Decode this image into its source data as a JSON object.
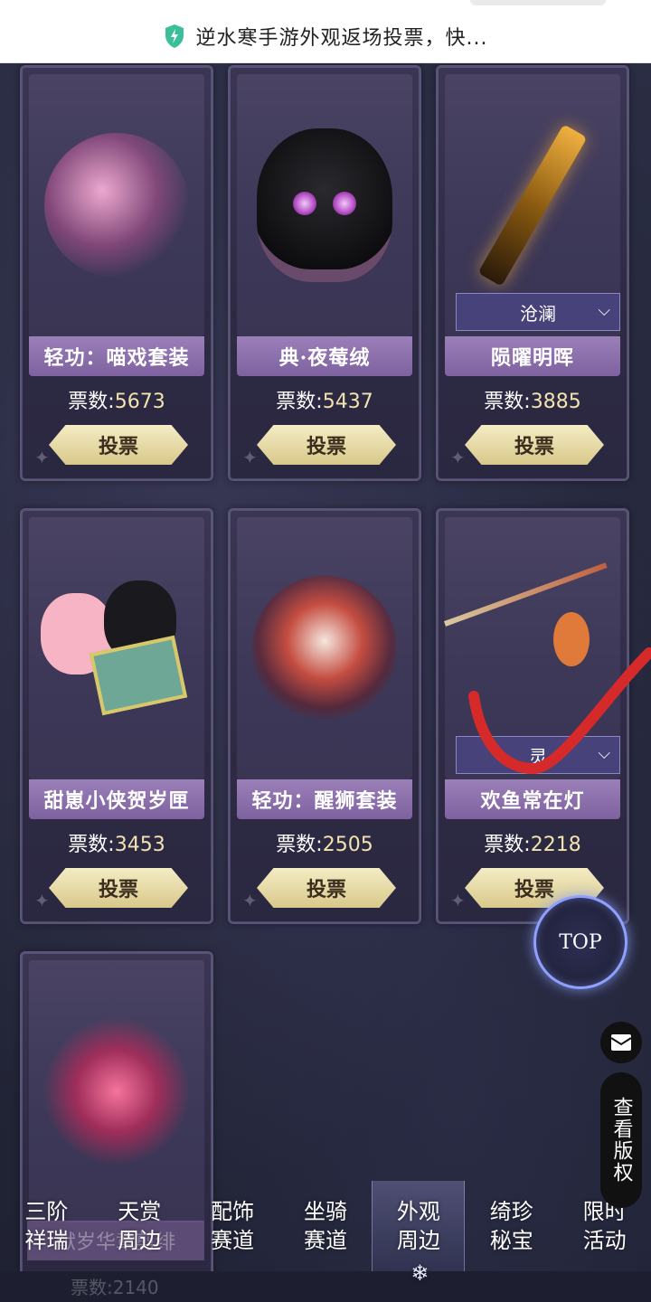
{
  "topbar": {
    "title": "逆水寒手游外观返场投票，快..."
  },
  "cards": [
    {
      "name": "轻功：喵戏套装",
      "votes_label": "票数:",
      "votes": "5673",
      "vote_label": "投票",
      "art": "pink-orb"
    },
    {
      "name": "典·夜莓绒",
      "votes_label": "票数:",
      "votes": "5437",
      "vote_label": "投票",
      "art": "black-cat"
    },
    {
      "name": "陨曜明晖",
      "votes_label": "票数:",
      "votes": "3885",
      "vote_label": "投票",
      "art": "golden-weapon",
      "select": "沧澜"
    },
    {
      "name": "甜崽小侠贺岁匣",
      "votes_label": "票数:",
      "votes": "3453",
      "vote_label": "投票",
      "art": "pets-gift"
    },
    {
      "name": "轻功：醒狮套装",
      "votes_label": "票数:",
      "votes": "2505",
      "vote_label": "投票",
      "art": "red-orb"
    },
    {
      "name": "欢鱼常在灯",
      "votes_label": "票数:",
      "votes": "2218",
      "vote_label": "投票",
      "art": "fish-lamp",
      "select": "灵"
    }
  ],
  "partial_card": {
    "name": "献岁华章剪绯",
    "votes": "票数:2140"
  },
  "top_button": "TOP",
  "copyright_button": "查看版权",
  "nav": [
    {
      "line1": "三阶",
      "line2": "祥瑞"
    },
    {
      "line1": "天赏",
      "line2": "周边"
    },
    {
      "line1": "配饰",
      "line2": "赛道"
    },
    {
      "line1": "坐骑",
      "line2": "赛道"
    },
    {
      "line1": "外观",
      "line2": "周边",
      "active": true
    },
    {
      "line1": "绮珍",
      "line2": "秘宝"
    },
    {
      "line1": "限时",
      "line2": "活动"
    }
  ],
  "colors": {
    "name_bar": "#8c6fb0",
    "vote_button": "#e8dca6",
    "check_mark": "#d62a2a",
    "top_ring": "#8fa0ff"
  }
}
